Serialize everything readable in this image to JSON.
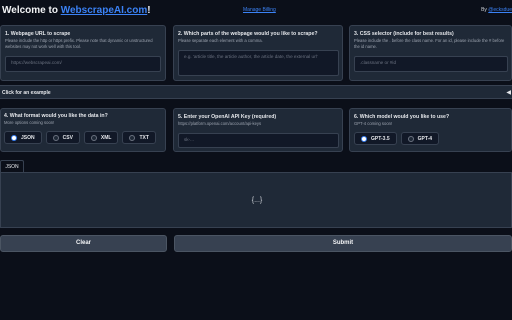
{
  "header": {
    "title_prefix": "Welcome to ",
    "title_link": "WebscrapeAI.com",
    "title_suffix": "!",
    "manage_billing": "Manage Billing",
    "by_prefix": "By ",
    "by_link": "@ecksdue"
  },
  "cards": [
    {
      "title": "1. Webpage URL to scrape",
      "desc": "Please include the http or https prefix. Please note that dynamic or unstructured websites may not work well with this tool.",
      "placeholder": "https://webscrapeai.com/"
    },
    {
      "title": "2. Which parts of the webpage would you like to scrape?",
      "desc": "Please separate each element with a comma.",
      "placeholder": "e.g. 'article title, the article author, the article date, the external url'"
    },
    {
      "title": "3. CSS selector (include for best results)",
      "desc": "Please include the . before the class name. For an id, please include the # before the id name.",
      "placeholder": ".classname or #id"
    },
    {
      "title": "4. What format would you like the data in?",
      "desc": "More options coming soon!"
    },
    {
      "title": "5. Enter your OpenAI API Key (required)",
      "desc": "https://platform.openai.com/account/api-keys",
      "placeholder": "sk-..."
    },
    {
      "title": "6. Which model would you like to use?",
      "desc": "GPT-4 coming soon!"
    }
  ],
  "formats": [
    {
      "label": "JSON",
      "selected": true
    },
    {
      "label": "CSV",
      "selected": false
    },
    {
      "label": "XML",
      "selected": false
    },
    {
      "label": "TXT",
      "selected": false
    }
  ],
  "models": [
    {
      "label": "GPT-3.5",
      "selected": true
    },
    {
      "label": "GPT-4",
      "selected": false
    }
  ],
  "example": {
    "label": "Click for an example",
    "arrow": "◀"
  },
  "output": {
    "tab": "JSON",
    "content": "{...}"
  },
  "buttons": {
    "clear": "Clear",
    "submit": "Submit"
  },
  "colors": {
    "background": "#0b0f19",
    "card": "#1f2937",
    "border": "#374151",
    "accent": "#3b82f6",
    "button": "#374151"
  }
}
